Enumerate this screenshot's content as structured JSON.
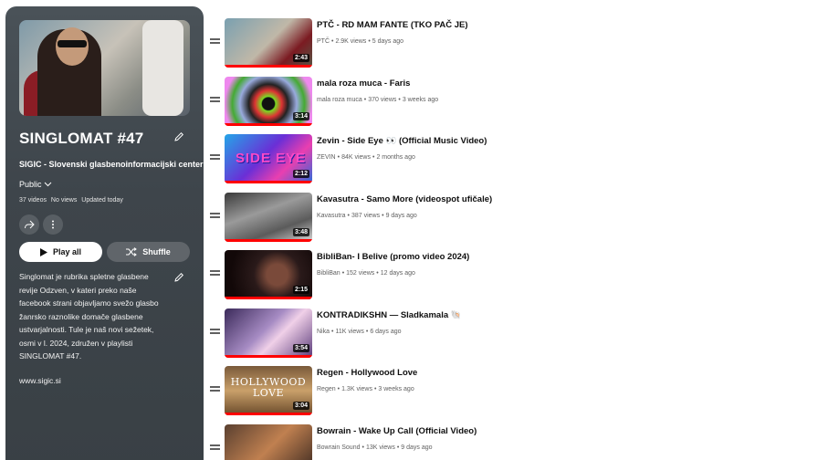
{
  "playlist": {
    "title": "SINGLOMAT #47",
    "owner": "SIGIC - Slovenski glasbenoinformacijski center",
    "privacy": "Public",
    "stats": [
      "37 videos",
      "No views",
      "Updated today"
    ],
    "play_all_label": "Play all",
    "shuffle_label": "Shuffle",
    "description": "Singlomat je rubrika spletne glasbene revije Odzven, v kateri preko naše facebook strani objavljamo svežo glasbo žanrsko raznolike domače glasbene ustvarjalnosti. Tule je naš novi sežetek, osmi v l. 2024, združen v playlisti SINGLOMAT #47.",
    "link": "www.sigic.si"
  },
  "videos": [
    {
      "title": "PTČ - RD MAM FANTE (TKO PAČ JE)",
      "channel": "PTČ",
      "views": "2.9K views",
      "age": "5 days ago",
      "duration": "2:43"
    },
    {
      "title": "mala roza muca - Faris",
      "channel": "mala roza muca",
      "views": "370 views",
      "age": "3 weeks ago",
      "duration": "3:14"
    },
    {
      "title": "Zevin - Side Eye 👀 (Official Music Video)",
      "channel": "ZEVIN",
      "views": "84K views",
      "age": "2 months ago",
      "duration": "2:12",
      "thumb_text": "SIDE EYE"
    },
    {
      "title": "Kavasutra - Samo More (videospot ufičale)",
      "channel": "Kavasutra",
      "views": "387 views",
      "age": "9 days ago",
      "duration": "3:48"
    },
    {
      "title": "BibliBan- I Belive (promo video 2024)",
      "channel": "BibliBan",
      "views": "152 views",
      "age": "12 days ago",
      "duration": "2:15"
    },
    {
      "title": "KONTRADIKSHN — Sladkamala 🐚",
      "channel": "Nika",
      "views": "11K views",
      "age": "6 days ago",
      "duration": "3:54"
    },
    {
      "title": "Regen - Hollywood Love",
      "channel": "Regen",
      "views": "1.3K views",
      "age": "3 weeks ago",
      "duration": "3:04",
      "thumb_text": "HOLLYWOOD LOVE"
    },
    {
      "title": "Bowrain - Wake Up Call (Official Video)",
      "channel": "Bowrain Sound",
      "views": "13K views",
      "age": "9 days ago",
      "duration": ""
    }
  ],
  "icons": {
    "edit": "pencil-icon",
    "share": "share-icon",
    "more": "more-vert-icon",
    "play": "play-icon",
    "shuffle": "shuffle-icon",
    "drag": "drag-handle-icon",
    "dropdown": "chevron-down-icon"
  },
  "colors": {
    "progress": "#ff0000",
    "sidebar": "#3e454b"
  }
}
